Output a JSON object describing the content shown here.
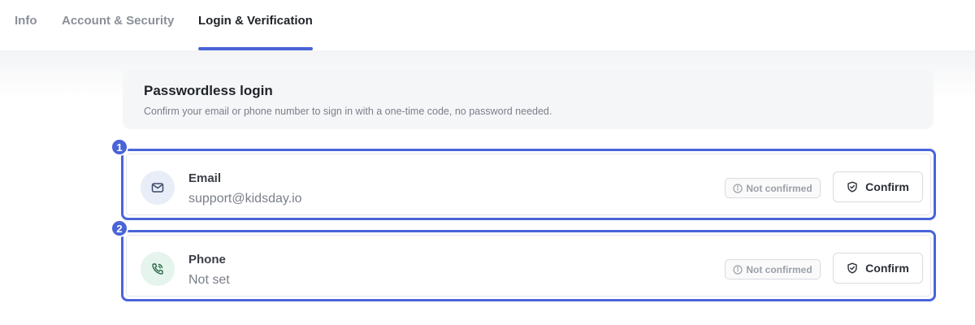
{
  "tabs": [
    {
      "label": "Info",
      "active": false
    },
    {
      "label": "Account & Security",
      "active": false
    },
    {
      "label": "Login & Verification",
      "active": true
    }
  ],
  "section": {
    "title": "Passwordless login",
    "description": "Confirm your email or phone number to sign in with a one-time code, no password needed."
  },
  "rows": [
    {
      "marker": "1",
      "icon": "mail-icon",
      "label": "Email",
      "value": "support@kidsday.io",
      "status": "Not confirmed",
      "action": "Confirm"
    },
    {
      "marker": "2",
      "icon": "phone-icon",
      "label": "Phone",
      "value": "Not set",
      "status": "Not confirmed",
      "action": "Confirm"
    }
  ],
  "colors": {
    "accent": "#4a64d8",
    "muted_text": "#7a7f88"
  }
}
